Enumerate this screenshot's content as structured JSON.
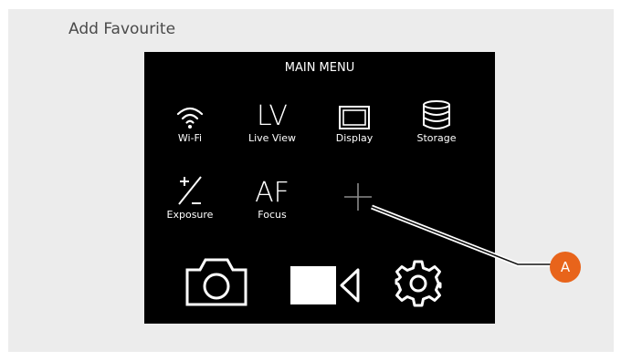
{
  "page": {
    "title": "Add Favourite"
  },
  "menu": {
    "title": "MAIN MENU",
    "items": [
      {
        "label": "Wi-Fi",
        "icon": "wifi-icon"
      },
      {
        "label": "Live View",
        "glyph": "LV"
      },
      {
        "label": "Display",
        "icon": "display-icon"
      },
      {
        "label": "Storage",
        "icon": "storage-icon"
      },
      {
        "label": "Exposure",
        "icon": "exposure-icon"
      },
      {
        "label": "Focus",
        "glyph": "AF"
      },
      {
        "label": "",
        "icon": "plus-icon"
      }
    ],
    "bottom": [
      {
        "icon": "camera-icon"
      },
      {
        "icon": "video-icon"
      },
      {
        "icon": "gear-icon"
      }
    ]
  },
  "callout": {
    "label": "A",
    "color": "#e8641b"
  }
}
